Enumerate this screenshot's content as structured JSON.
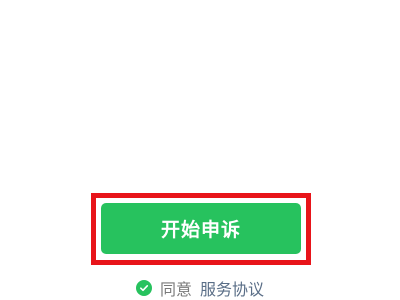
{
  "main": {
    "start_button_label": "开始申诉"
  },
  "agreement": {
    "agree_text": "同意",
    "link_text": "服务协议",
    "checked": true
  },
  "colors": {
    "accent": "#27c25e",
    "highlight": "#e8141a",
    "link": "#5a6e87",
    "muted_text": "#7a7a7a"
  },
  "icons": {
    "check": "checkmark-circle-icon"
  }
}
